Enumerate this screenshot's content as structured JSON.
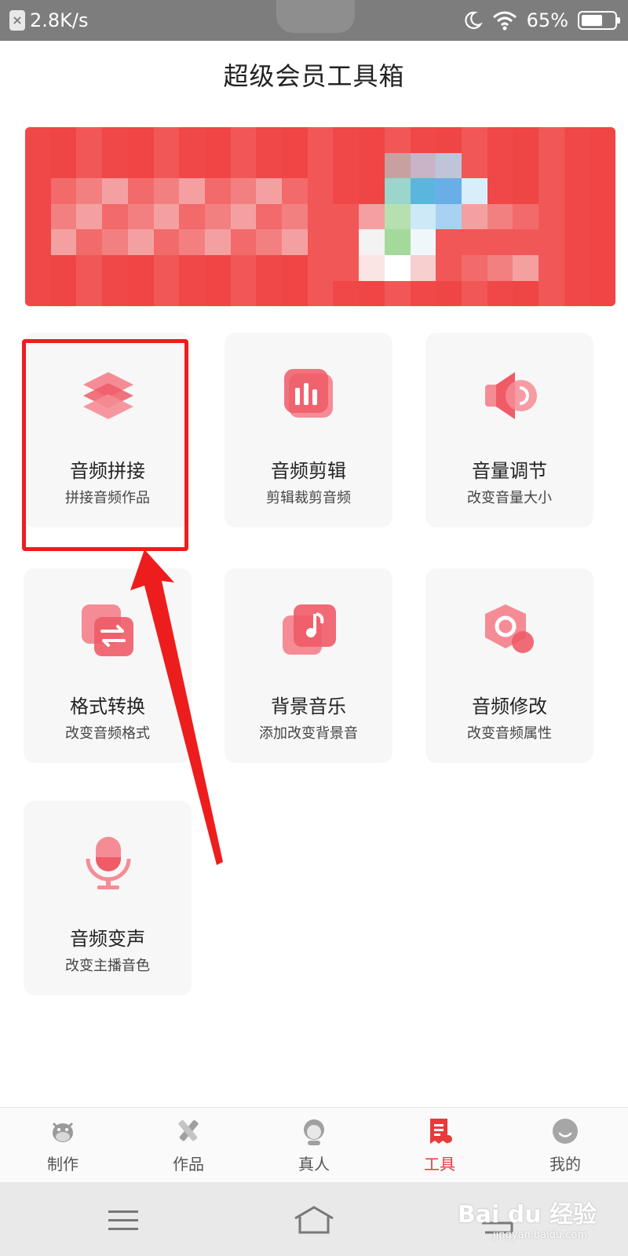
{
  "status_bar": {
    "speed": "2.8K/s",
    "battery_pct": "65%",
    "battery_level": 0.65,
    "icons": [
      "close-badge-icon",
      "moon-icon",
      "wifi-icon",
      "battery-icon"
    ]
  },
  "header": {
    "title": "超级会员工具箱"
  },
  "banner": {
    "description_visible": false
  },
  "tools": [
    {
      "title": "音频拼接",
      "subtitle": "拼接音频作品",
      "icon": "layers-icon"
    },
    {
      "title": "音频剪辑",
      "subtitle": "剪辑裁剪音频",
      "icon": "bar-chart-icon"
    },
    {
      "title": "音量调节",
      "subtitle": "改变音量大小",
      "icon": "speaker-icon"
    },
    {
      "title": "格式转换",
      "subtitle": "改变音频格式",
      "icon": "swap-icon"
    },
    {
      "title": "背景音乐",
      "subtitle": "添加改变背景音",
      "icon": "music-note-icon"
    },
    {
      "title": "音频修改",
      "subtitle": "改变音频属性",
      "icon": "hexagon-icon"
    },
    {
      "title": "音频变声",
      "subtitle": "改变主播音色",
      "icon": "microphone-icon"
    }
  ],
  "bottom_nav": [
    {
      "label": "制作",
      "icon": "cow-mascot-icon",
      "active": false
    },
    {
      "label": "作品",
      "icon": "pencil-ruler-icon",
      "active": false
    },
    {
      "label": "真人",
      "icon": "person-avatar-icon",
      "active": false
    },
    {
      "label": "工具",
      "icon": "toolbox-doc-icon",
      "active": true
    },
    {
      "label": "我的",
      "icon": "smiley-face-icon",
      "active": false
    }
  ],
  "watermark": {
    "text": "Bai du 经验",
    "sub": "jingyan.baidu.com"
  },
  "colors": {
    "accent": "#e83a3a",
    "icon_pink": "#f58c95",
    "icon_red": "#ef5b67",
    "highlight": "#ee1d1d",
    "card_bg": "#f7f7f7"
  }
}
